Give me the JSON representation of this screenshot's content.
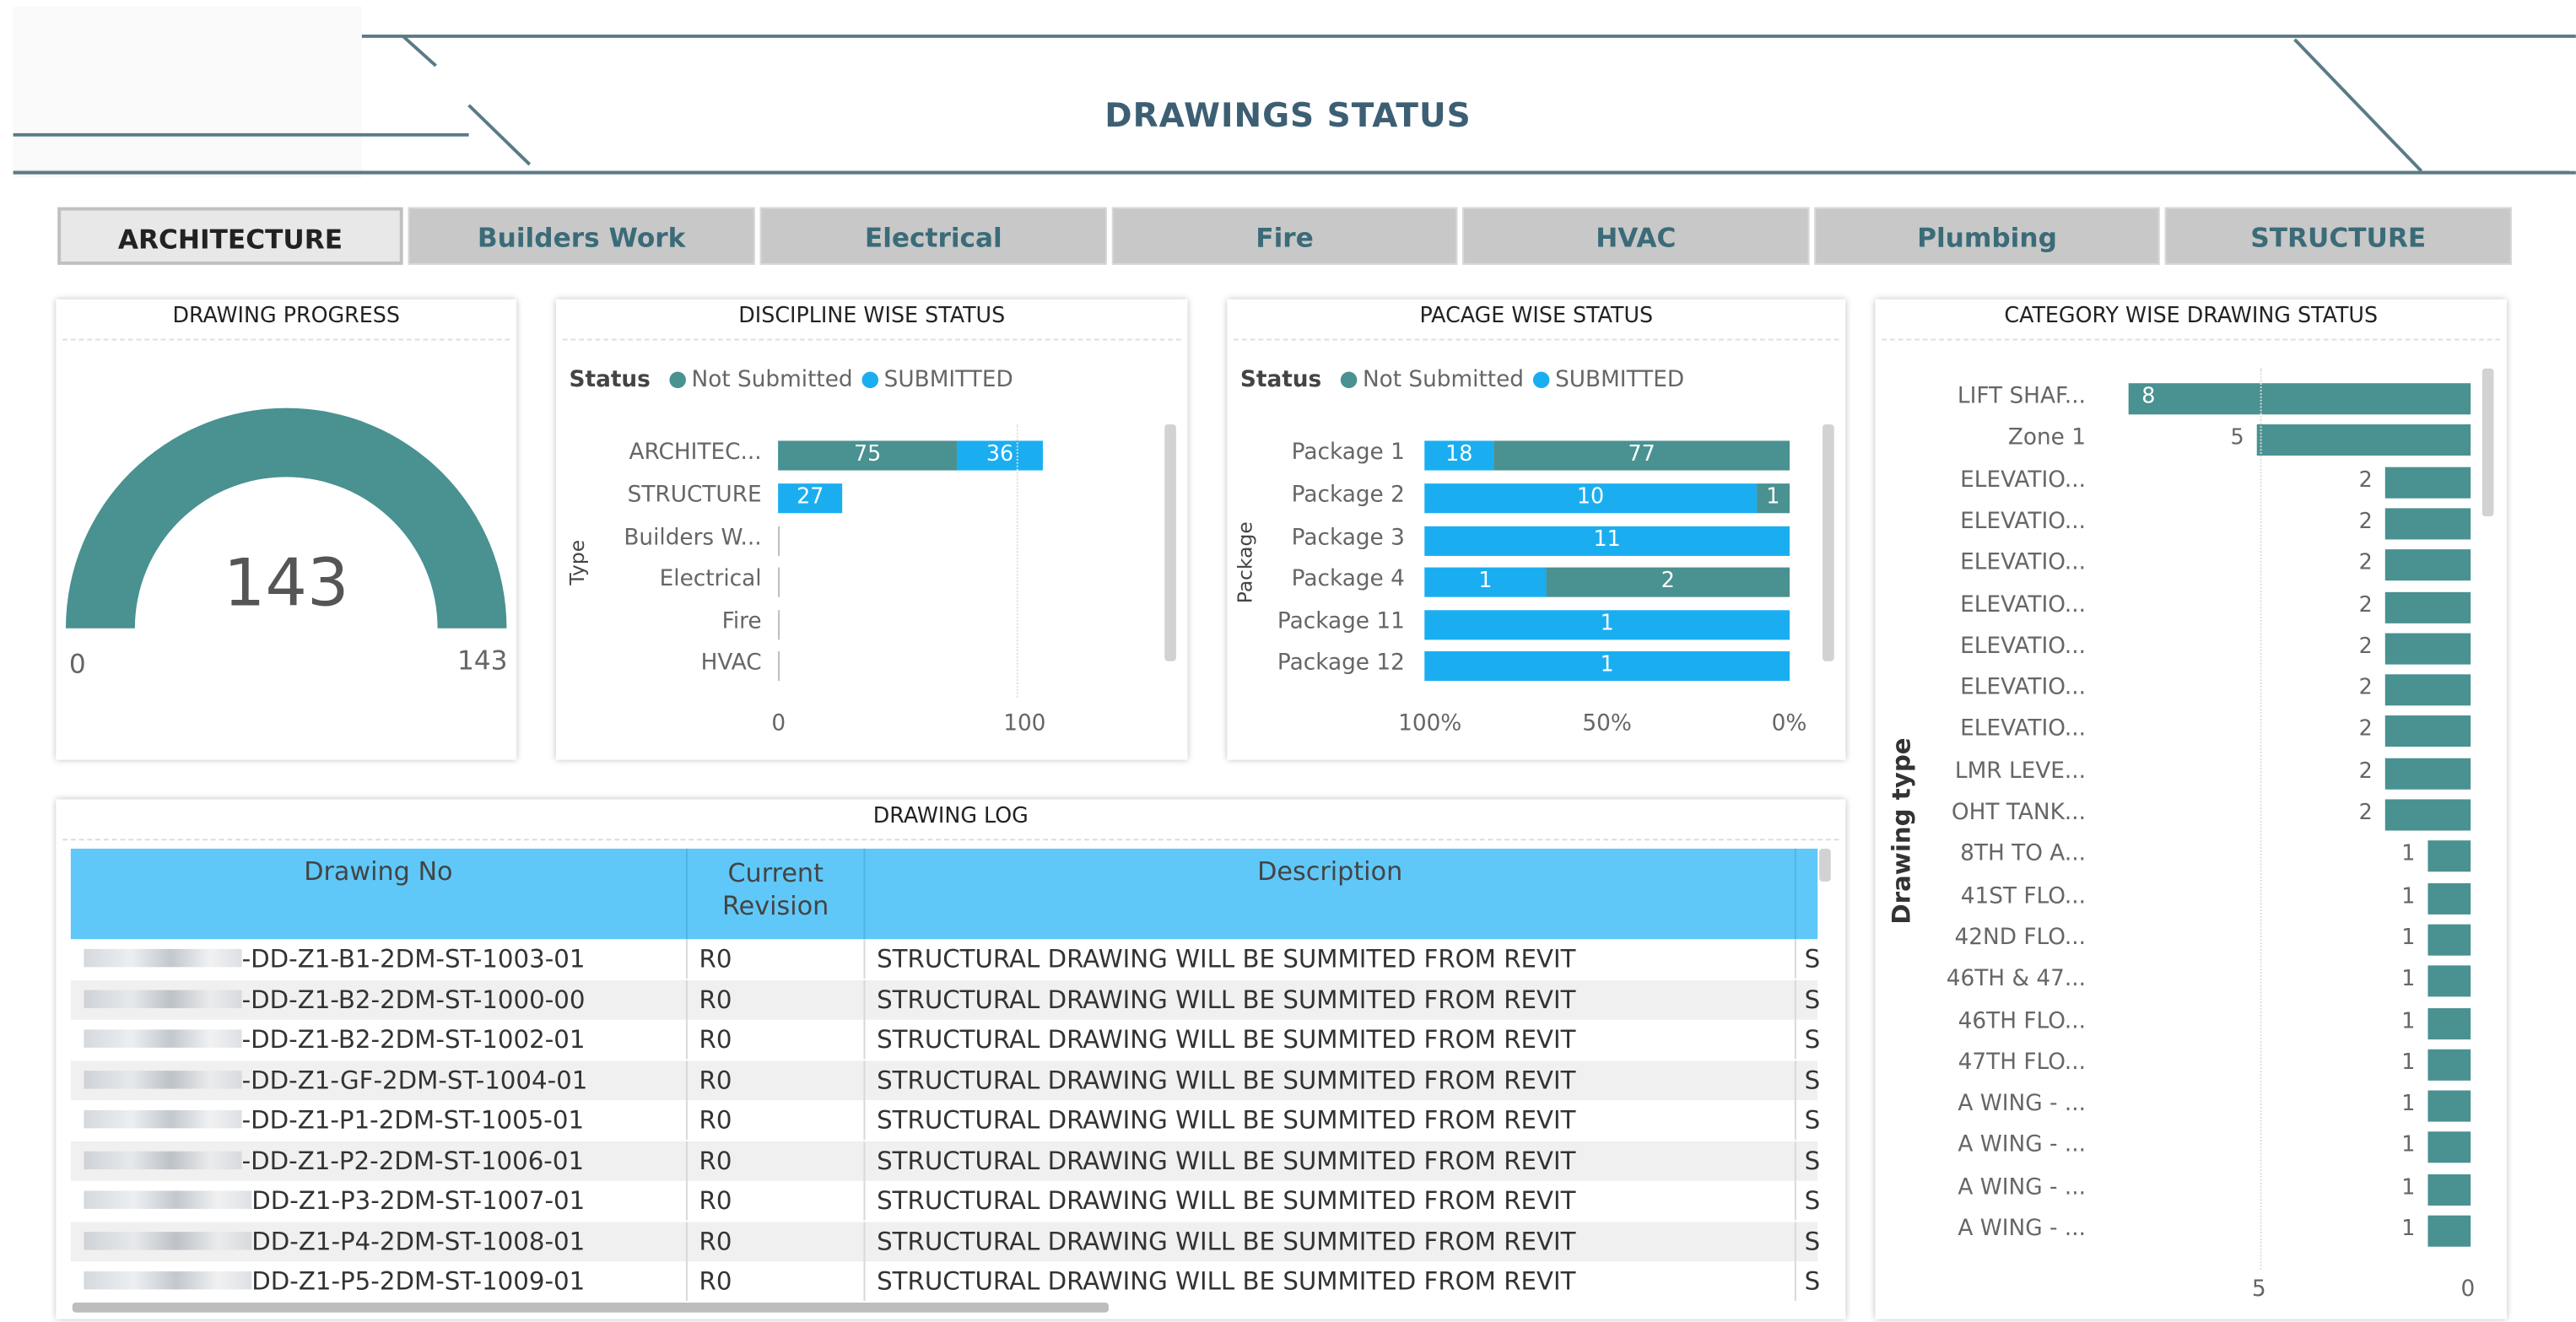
{
  "header": {
    "title": "DRAWINGS STATUS",
    "accent_line_color": "#5a7b86"
  },
  "tabs": [
    {
      "label": "ARCHITECTURE",
      "active": true
    },
    {
      "label": "Builders Work",
      "active": false
    },
    {
      "label": "Electrical",
      "active": false
    },
    {
      "label": "Fire",
      "active": false
    },
    {
      "label": "HVAC",
      "active": false
    },
    {
      "label": "Plumbing",
      "active": false
    },
    {
      "label": "STRUCTURE",
      "active": false
    }
  ],
  "colors": {
    "not_submitted": "#4a9191",
    "submitted": "#1aaef1",
    "table_header": "#5fc8f8"
  },
  "drawing_progress": {
    "title": "DRAWING PROGRESS",
    "value": "143",
    "min_label": "0",
    "max_label": "143",
    "fraction": 1.0
  },
  "discipline_status": {
    "title": "DISCIPLINE WISE STATUS",
    "legend_title": "Status",
    "legend": [
      "Not Submitted",
      "SUBMITTED"
    ],
    "axis_title": "Type",
    "ticks": [
      "0",
      "100"
    ]
  },
  "package_status": {
    "title": "PACAGE WISE STATUS",
    "legend_title": "Status",
    "legend": [
      "Not Submitted",
      "SUBMITTED"
    ],
    "axis_title": "Package",
    "ticks": [
      "100%",
      "50%",
      "0%"
    ]
  },
  "category_status": {
    "title": "CATEGORY WISE DRAWING STATUS",
    "axis_title": "Drawing type",
    "ticks": [
      "5",
      "0"
    ]
  },
  "drawing_log": {
    "title": "DRAWING LOG",
    "columns": [
      "Drawing No",
      "Current\nRevision",
      "Description"
    ],
    "rows": [
      {
        "no": "-DD-Z1-B1-2DM-ST-1003-01",
        "rev": "R0",
        "desc": "STRUCTURAL DRAWING WILL BE SUMMITED FROM REVIT",
        "extra": "S"
      },
      {
        "no": "-DD-Z1-B2-2DM-ST-1000-00",
        "rev": "R0",
        "desc": "STRUCTURAL DRAWING WILL BE SUMMITED FROM REVIT",
        "extra": "S"
      },
      {
        "no": "-DD-Z1-B2-2DM-ST-1002-01",
        "rev": "R0",
        "desc": "STRUCTURAL DRAWING WILL BE SUMMITED FROM REVIT",
        "extra": "S"
      },
      {
        "no": "-DD-Z1-GF-2DM-ST-1004-01",
        "rev": "R0",
        "desc": "STRUCTURAL DRAWING WILL BE SUMMITED FROM REVIT",
        "extra": "S"
      },
      {
        "no": "-DD-Z1-P1-2DM-ST-1005-01",
        "rev": "R0",
        "desc": "STRUCTURAL DRAWING WILL BE SUMMITED FROM REVIT",
        "extra": "S"
      },
      {
        "no": "-DD-Z1-P2-2DM-ST-1006-01",
        "rev": "R0",
        "desc": "STRUCTURAL DRAWING WILL BE SUMMITED FROM REVIT",
        "extra": "S"
      },
      {
        "no": "DD-Z1-P3-2DM-ST-1007-01",
        "rev": "R0",
        "desc": "STRUCTURAL DRAWING WILL BE SUMMITED FROM REVIT",
        "extra": "S"
      },
      {
        "no": "DD-Z1-P4-2DM-ST-1008-01",
        "rev": "R0",
        "desc": "STRUCTURAL DRAWING WILL BE SUMMITED FROM REVIT",
        "extra": "S"
      },
      {
        "no": "DD-Z1-P5-2DM-ST-1009-01",
        "rev": "R0",
        "desc": "STRUCTURAL DRAWING WILL BE SUMMITED FROM REVIT",
        "extra": "S"
      }
    ]
  },
  "chart_data": [
    {
      "type": "bar",
      "title": "DISCIPLINE WISE STATUS",
      "ylabel": "Type",
      "orientation": "horizontal",
      "stacked": true,
      "categories": [
        "ARCHITEC...",
        "STRUCTURE",
        "Builders W...",
        "Electrical",
        "Fire",
        "HVAC"
      ],
      "series": [
        {
          "name": "Not Submitted",
          "values": [
            75,
            0,
            0,
            0,
            0,
            0
          ]
        },
        {
          "name": "SUBMITTED",
          "values": [
            36,
            27,
            0,
            0,
            0,
            0
          ]
        }
      ],
      "xlim": [
        0,
        150
      ],
      "xticks": [
        "0",
        "100"
      ],
      "legend": "top-left"
    },
    {
      "type": "bar",
      "title": "PACAGE WISE STATUS",
      "ylabel": "Package",
      "orientation": "horizontal",
      "stacked": true,
      "percent": true,
      "categories": [
        "Package 1",
        "Package 2",
        "Package 3",
        "Package 4",
        "Package 11",
        "Package 12"
      ],
      "series": [
        {
          "name": "SUBMITTED",
          "values": [
            18,
            10,
            11,
            1,
            1,
            1
          ]
        },
        {
          "name": "Not Submitted",
          "values": [
            77,
            1,
            0,
            2,
            0,
            0
          ]
        }
      ],
      "xticks": [
        "100%",
        "50%",
        "0%"
      ],
      "legend": "top-left"
    },
    {
      "type": "bar",
      "title": "CATEGORY WISE DRAWING STATUS",
      "ylabel": "Drawing type",
      "orientation": "horizontal",
      "categories": [
        "LIFT SHAF...",
        "Zone 1",
        "ELEVATIO...",
        "ELEVATIO...",
        "ELEVATIO...",
        "ELEVATIO...",
        "ELEVATIO...",
        "ELEVATIO...",
        "ELEVATIO...",
        "LMR LEVE...",
        "OHT TANK...",
        "8TH TO A...",
        "41ST FLO...",
        "42ND FLO...",
        "46TH & 47...",
        "46TH FLO...",
        "47TH FLO...",
        "A WING - ...",
        "A WING - ...",
        "A WING - ...",
        "A WING - ..."
      ],
      "values": [
        8,
        5,
        2,
        2,
        2,
        2,
        2,
        2,
        2,
        2,
        2,
        1,
        1,
        1,
        1,
        1,
        1,
        1,
        1,
        1,
        1
      ],
      "xlim": [
        8,
        0
      ],
      "xticks": [
        "5",
        "0"
      ]
    }
  ]
}
